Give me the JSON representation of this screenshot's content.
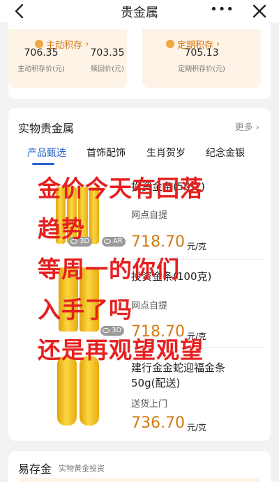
{
  "header": {
    "title": "贵金属",
    "back_icon": "chevron-left-icon",
    "more_label": "•••",
    "close_icon": "close-icon"
  },
  "top_section": {
    "left_button": "主动积存",
    "right_button": "定期积存",
    "active_price": "706.35",
    "active_price_label": "主动积存价(元)",
    "buyback_price": "703.35",
    "buyback_price_label": "赎回价(元)",
    "periodic_price": "705.13",
    "periodic_price_label": "定期积存价(元)"
  },
  "physical": {
    "title": "实物贵金属",
    "more": "更多 ›",
    "tabs": [
      "产品甄选",
      "首饰配饰",
      "生肖贺岁",
      "纪念金银"
    ],
    "active_tab": 0,
    "products": [
      {
        "name": "投资金条(50克)",
        "delivery": "网点自提",
        "price": "718.70",
        "unit": "元/克",
        "badges": [
          "3D",
          "AR"
        ]
      },
      {
        "name": "投资金条(100克)",
        "delivery": "网点自提",
        "price": "718.70",
        "unit": "元/克",
        "badges": [
          "3D"
        ]
      },
      {
        "name_line1": "建行金金蛇迎福金条",
        "name_line2": "50g(配送)",
        "delivery": "送货上门",
        "price": "736.70",
        "unit": "元/克"
      }
    ],
    "overlay_lines": [
      "金价今天有回落",
      "趋势",
      "等周一的你们",
      "入手了吗",
      "还是再观望观望"
    ]
  },
  "easy_gold": {
    "title": "易存金",
    "subtitle": "实物黄金投资"
  },
  "colors": {
    "accent_blue": "#2865c9",
    "price_orange": "#d27a14",
    "overlay_red": "#e52020",
    "gold": "#fbd741"
  }
}
